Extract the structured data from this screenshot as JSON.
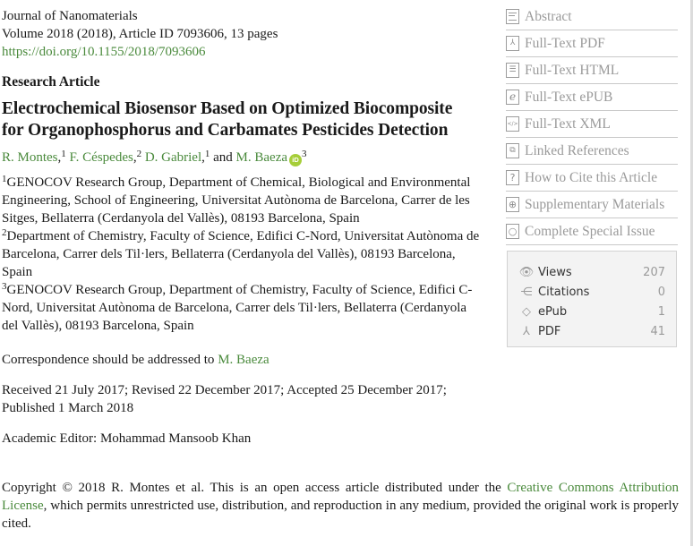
{
  "header": {
    "journal": "Journal of Nanomaterials",
    "volume_line": "Volume 2018 (2018), Article ID 7093606, 13 pages",
    "doi": "https://doi.org/10.1155/2018/7093606"
  },
  "article": {
    "type": "Research Article",
    "title": "Electrochemical Biosensor Based on Optimized Biocomposite for Organophosphorus and Carbamates Pesticides Detection",
    "authors": [
      {
        "name": "R. Montes",
        "sup": "1",
        "sep": ", "
      },
      {
        "name": "F. Céspedes",
        "sup": "2",
        "sep": " "
      },
      {
        "name": "D. Gabriel",
        "sup": "1",
        "sep": " and "
      },
      {
        "name": "M. Baeza",
        "sup": "3",
        "sep": ""
      }
    ],
    "author_seps": [
      ",",
      ",",
      ","
    ],
    "orcid_label": "iD",
    "affiliations": [
      {
        "sup": "1",
        "text": "GENOCOV Research Group, Department of Chemical, Biological and Environmental Engineering, School of Engineering, Universitat Autònoma de Barcelona, Carrer de les Sitges, Bellaterra (Cerdanyola del Vallès), 08193 Barcelona, Spain"
      },
      {
        "sup": "2",
        "text": "Department of Chemistry, Faculty of Science, Edifici C-Nord, Universitat Autònoma de Barcelona, Carrer dels Til·lers, Bellaterra (Cerdanyola del Vallès), 08193 Barcelona, Spain"
      },
      {
        "sup": "3",
        "text": "GENOCOV Research Group, Department of Chemistry, Faculty of Science, Edifici C-Nord, Universitat Autònoma de Barcelona, Carrer dels Til·lers, Bellaterra (Cerdanyola del Vallès), 08193 Barcelona, Spain"
      }
    ],
    "correspondence_prefix": "Correspondence should be addressed to ",
    "correspondence_name": "M. Baeza",
    "dates": "Received 21 July 2017; Revised 22 December 2017; Accepted 25 December 2017; Published 1 March 2018",
    "editor": "Academic Editor: Mohammad Mansoob Khan",
    "copyright_prefix": "Copyright © 2018 R. Montes et al. This is an open access article distributed under the ",
    "copyright_link": "Creative Commons Attribution License",
    "copyright_suffix": ", which permits unrestricted use, distribution, and reproduction in any medium, provided the original work is properly cited."
  },
  "sidebar": {
    "items": [
      {
        "label": "Abstract",
        "icon": "lines-icon"
      },
      {
        "label": "Full-Text PDF",
        "icon": "pdf-icon"
      },
      {
        "label": "Full-Text HTML",
        "icon": "html-icon"
      },
      {
        "label": "Full-Text ePUB",
        "icon": "epub-icon"
      },
      {
        "label": "Full-Text XML",
        "icon": "xml-icon"
      },
      {
        "label": "Linked References",
        "icon": "linked-references-icon"
      },
      {
        "label": "How to Cite this Article",
        "icon": "question-icon"
      },
      {
        "label": "Supplementary Materials",
        "icon": "plus-circle-icon"
      },
      {
        "label": "Complete Special Issue",
        "icon": "circle-icon"
      }
    ]
  },
  "stats": [
    {
      "label": "Views",
      "value": "207",
      "icon": "eye-icon"
    },
    {
      "label": "Citations",
      "value": "0",
      "icon": "share-icon"
    },
    {
      "label": "ePub",
      "value": "1",
      "icon": "epub-icon"
    },
    {
      "label": "PDF",
      "value": "41",
      "icon": "pdf-icon"
    }
  ],
  "colors": {
    "link": "#4a8a3c",
    "sidebar_text": "#9a9a9a",
    "orcid": "#a6ce39"
  }
}
